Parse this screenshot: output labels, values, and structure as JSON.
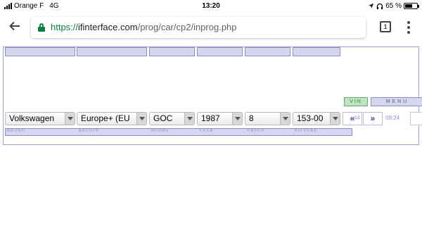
{
  "status_bar": {
    "carrier": "Orange F",
    "network": "4G",
    "time": "13:20",
    "battery": "65 %",
    "battery_level": 0.65,
    "icons": [
      "location-arrow-icon",
      "headphones-icon",
      "battery-icon"
    ]
  },
  "browser": {
    "url_scheme": "https://",
    "url_host": "ifinterface.com",
    "url_path": "/prog/car/cp2/inprog.php",
    "tab_count": "1",
    "icons": [
      "back-arrow-icon",
      "lock-icon",
      "tabs-icon",
      "more-vert-icon"
    ]
  },
  "app": {
    "vin_button": "VIN",
    "menu_button": "MENU",
    "selectors": {
      "brand": "Volkswagen",
      "region": "Europe+ (EU",
      "model": "GOC",
      "year": "1987",
      "group": "8",
      "picture": "153-00"
    },
    "nav": {
      "prev_label": "«",
      "next_label": "»",
      "prev_ghost": "44",
      "time": "09:24"
    },
    "labels": {
      "brand": "BRAND",
      "region": "REGION",
      "model": "MODEL",
      "year": "YEAR",
      "group": "GROUP",
      "picture": "PICTURE"
    },
    "colors": {
      "bar_fill": "#d4d7ee",
      "bar_border": "#8b8fc6",
      "vin_green": "#bde6c0",
      "url_green": "#0b8043"
    }
  }
}
